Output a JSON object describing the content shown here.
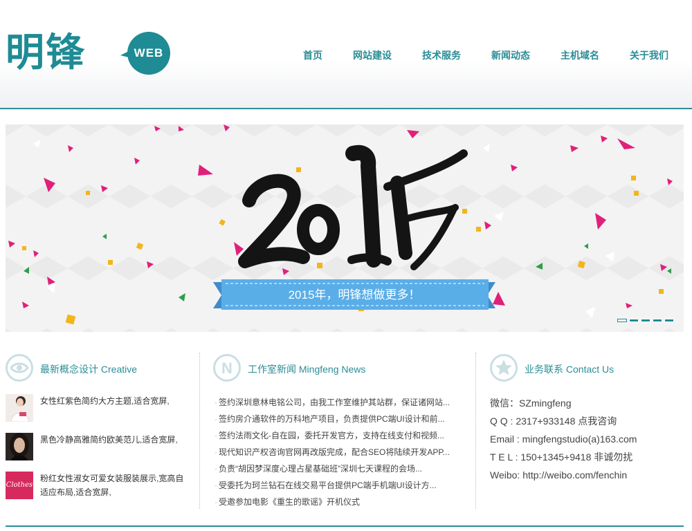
{
  "logo": {
    "brand": "明锋",
    "badge": "WEB"
  },
  "nav": {
    "items": [
      {
        "label": "首页"
      },
      {
        "label": "网站建设"
      },
      {
        "label": "技术服务"
      },
      {
        "label": "新闻动态"
      },
      {
        "label": "主机域名"
      },
      {
        "label": "关于我们"
      }
    ]
  },
  "banner": {
    "year": "2015",
    "slogan": "2015年，明锋想做更多！",
    "slides": 5,
    "active_slide": 1
  },
  "creative": {
    "title": "最新概念设计 Creative",
    "icon": "eye-icon",
    "items": [
      {
        "thumb_label": "",
        "text": "女性红紫色简约大方主题,适合宽屏,"
      },
      {
        "thumb_label": "",
        "text": "黑色冷静高雅简约欧美范儿,适合宽屏,"
      },
      {
        "thumb_label": "Clothes",
        "text": "粉红女性淑女可爱女装服装展示,宽高自适应布局,适合宽屏,"
      }
    ]
  },
  "news": {
    "title": "工作室新闻 Mingfeng News",
    "icon": "news-n-icon",
    "items": [
      "签约深圳意林电铭公司，由我工作室维护其站群，保证诸网站...",
      "签约房介通软件的万科地产项目，负责提供PC端UI设计和前...",
      "签约法雨文化-自在园，委托开发官方，支持在线支付和视频...",
      "现代知识产权咨询官网再改版完成，配合SEO将陆续开发APP...",
      "负责“胡因梦深度心理占星基础班”深圳七天课程的会场...",
      "受委托为珂兰钻石在线交易平台提供PC端手机端UI设计方...",
      "受邀参加电影《重生的歌谣》开机仪式"
    ]
  },
  "contact": {
    "title": "业务联系 Contact Us",
    "icon": "star-icon",
    "lines": [
      "微信：SZmingfeng",
      "Q Q : 2317+933148 点我咨询",
      "Email : mingfengstudio(a)163.com",
      "T E L : 150+1345+9418 非诚勿扰",
      "Weibo: http://weibo.com/fenchin"
    ]
  },
  "colors": {
    "accent": "#2a8d96",
    "ribbon": "#5aaee8",
    "confetti_pink": "#e0207a",
    "confetti_yellow": "#f2b51c",
    "confetti_green": "#2aa04a"
  }
}
